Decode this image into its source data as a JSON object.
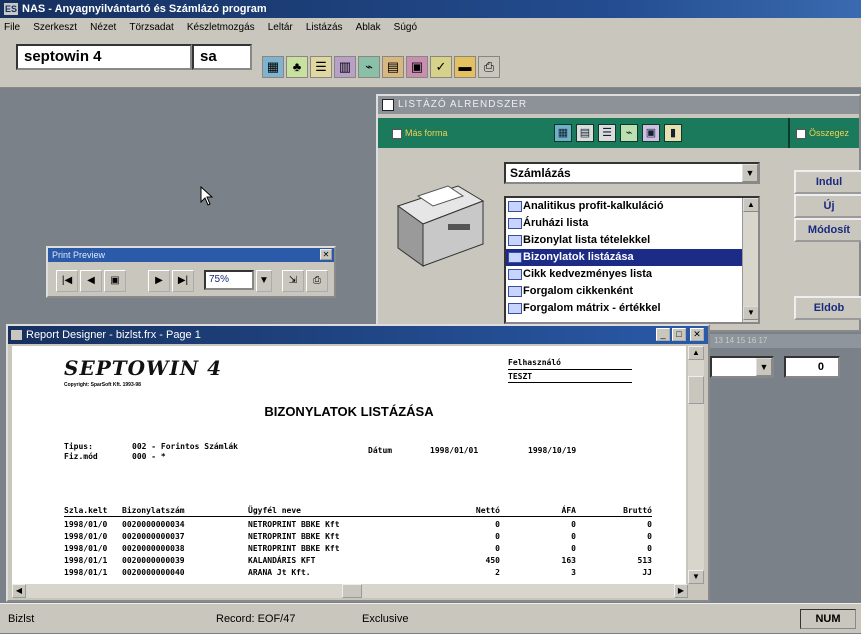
{
  "app": {
    "title": "NAS - Anyagnyilvántartó és Számlázó program",
    "icon_text": "ES"
  },
  "menu": [
    "File",
    "Szerkeszt",
    "Nézet",
    "Törzsadat",
    "Készletmozgás",
    "Leltár",
    "Listázás",
    "Ablak",
    "Súgó"
  ],
  "toolbar": {
    "company_combo": "septowin 4",
    "user_combo": "sa",
    "buttons": [
      "grid-icon",
      "tree-icon",
      "list-icon",
      "book-icon",
      "chart-icon",
      "calendar-icon",
      "dialog-icon",
      "check-icon",
      "folder-icon",
      "printer-icon"
    ]
  },
  "listazo": {
    "title": "LISTÁZÓ ALRENDSZER",
    "mas_forma": "Más forma",
    "osszegez": "Összegez",
    "category_value": "Számlázás",
    "reports": [
      "Analitikus profit-kalkuláció",
      "Áruházi lista",
      "Bizonylat lista tételekkel",
      "Bizonylatok listázása",
      "Cikk kedvezményes lista",
      "Forgalom cikkenként",
      "Forgalom mátrix - értékkel"
    ],
    "selected_index": 3,
    "buttons": {
      "indul": "Indul",
      "uj": "Új",
      "modosit": "Módosít",
      "eldob": "Eldob"
    }
  },
  "print_preview": {
    "title": "Print Preview",
    "zoom": "75%"
  },
  "report_designer": {
    "title": "Report Designer - bizlst.frx - Page 1",
    "logo": "SEPTOWIN 4",
    "copyright": "Copyright: SparSoft Kft. 1993-98",
    "user_label": "Felhasználó",
    "user_value": "TESZT",
    "report_title": "BIZONYLATOK LISTÁZÁSA",
    "tipus_label": "Tipus:",
    "tipus_value": "002 - Forintos Számlák",
    "fizmod_label": "Fiz.mód",
    "fizmod_value": "000 - *",
    "datum_label": "Dátum",
    "date_from": "1998/01/01",
    "date_to": "1998/10/19",
    "columns": [
      "Szla.kelt",
      "Bizonylatszám",
      "Ügyfél neve",
      "Nettó",
      "ÁFA",
      "Bruttó"
    ],
    "rows": [
      [
        "1998/01/0",
        "0020000000034",
        "NETROPRINT BBKE Kft",
        "0",
        "0",
        "0"
      ],
      [
        "1998/01/0",
        "0020000000037",
        "NETROPRINT BBKE Kft",
        "0",
        "0",
        "0"
      ],
      [
        "1998/01/0",
        "0020000000038",
        "NETROPRINT BBKE Kft",
        "0",
        "0",
        "0"
      ],
      [
        "1998/01/1",
        "0020000000039",
        "KALANDÁRIS KFT",
        "450",
        "163",
        "513"
      ],
      [
        "1998/01/1",
        "0020000000040",
        "ARANA Jt Kft.",
        "2",
        "3",
        "JJ"
      ]
    ]
  },
  "right_panel": {
    "ruler": "13  14  15  16  17",
    "number_value": "0"
  },
  "status": {
    "left": "Bizlst",
    "record": "Record: EOF/47",
    "mode": "Exclusive",
    "num": "NUM"
  }
}
